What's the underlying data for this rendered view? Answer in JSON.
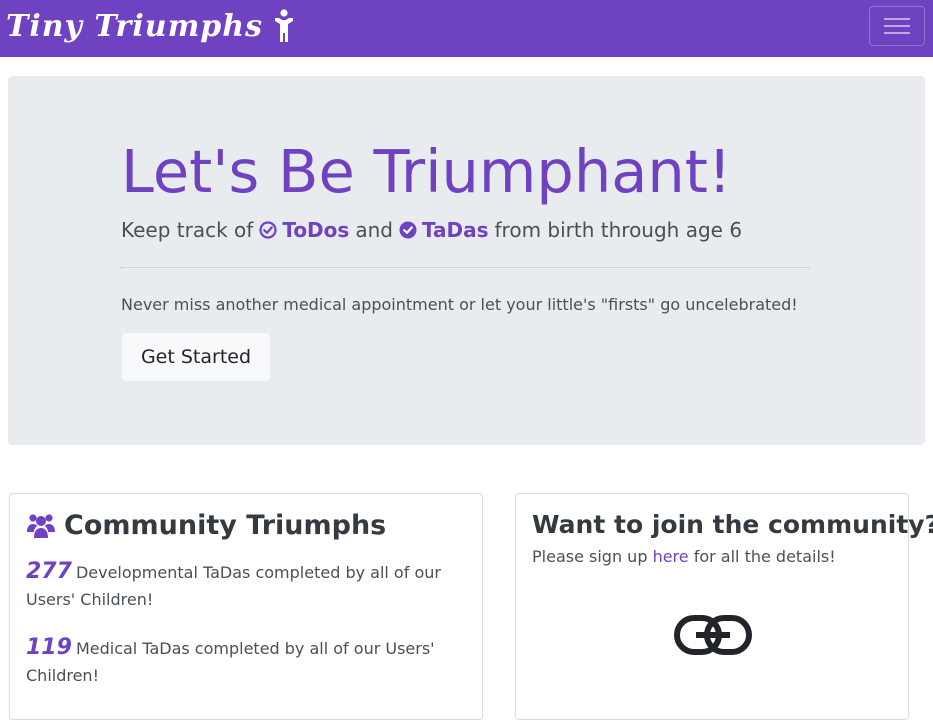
{
  "navbar": {
    "brand": "Tiny Triumphs",
    "brand_icon": "child-icon",
    "toggle_icon": "hamburger-menu-icon"
  },
  "hero": {
    "title": "Let's Be Triumphant!",
    "lead_prefix": "Keep track of",
    "todos_label": "ToDos",
    "and_word": "and",
    "tadas_label": "TaDas",
    "lead_suffix": "from birth through age 6",
    "description": "Never miss another medical appointment or let your little's \"firsts\" go uncelebrated!",
    "cta_label": "Get Started"
  },
  "community": {
    "title": "Community Triumphs",
    "icon": "users-icon",
    "stats": [
      {
        "count": "277",
        "text": "Developmental TaDas completed by all of our Users' Children!"
      },
      {
        "count": "119",
        "text": "Medical TaDas completed by all of our Users' Children!"
      }
    ]
  },
  "join": {
    "title": "Want to join the community?",
    "text_before": "Please sign up",
    "link_label": "here",
    "text_after": "for all the details!",
    "icon": "link-icon"
  },
  "colors": {
    "accent": "#6f42c1",
    "hero_bg": "#e9ecef",
    "muted_text": "#495057"
  }
}
